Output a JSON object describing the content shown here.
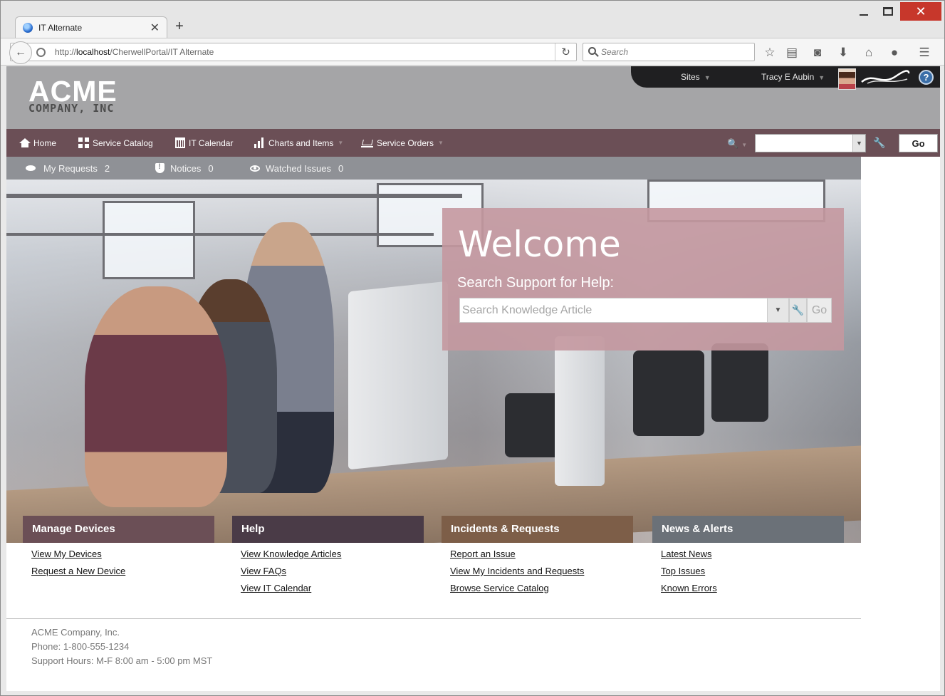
{
  "browser": {
    "tab_title": "IT Alternate",
    "url_prefix": "http://",
    "url_host": "localhost",
    "url_path": "/CherwellPortal/IT Alternate",
    "search_placeholder": "Search"
  },
  "header": {
    "logo_main": "ACME",
    "logo_sub": "COMPANY, INC",
    "sites_label": "Sites",
    "user_name": "Tracy E Aubin",
    "help_label": "?"
  },
  "nav": {
    "items": [
      {
        "label": "Home"
      },
      {
        "label": "Service Catalog"
      },
      {
        "label": "IT Calendar"
      },
      {
        "label": "Charts and Items"
      },
      {
        "label": "Service Orders"
      }
    ],
    "go_label": "Go"
  },
  "subnav": {
    "my_requests": {
      "label": "My Requests",
      "count": "2"
    },
    "notices": {
      "label": "Notices",
      "count": "0"
    },
    "watched": {
      "label": "Watched Issues",
      "count": "0"
    }
  },
  "welcome": {
    "title": "Welcome",
    "subtitle": "Search Support for Help:",
    "search_placeholder": "Search Knowledge Article",
    "go_label": "Go"
  },
  "tiles": [
    {
      "title": "Manage Devices",
      "color": "#6b4f56",
      "links": [
        "View My Devices",
        "Request a New Device"
      ]
    },
    {
      "title": "Help",
      "color": "#4a3b47",
      "links": [
        "View Knowledge Articles",
        "View FAQs",
        "View IT Calendar"
      ]
    },
    {
      "title": "Incidents & Requests",
      "color": "#7d5e48",
      "links": [
        "Report an Issue",
        "View My Incidents and Requests",
        "Browse Service Catalog"
      ]
    },
    {
      "title": "News & Alerts",
      "color": "#6b7178",
      "links": [
        "Latest News",
        "Top Issues",
        "Known Errors"
      ]
    }
  ],
  "footer": {
    "company": "ACME Company, Inc.",
    "phone": "Phone: 1-800-555-1234",
    "hours": "Support Hours: M-F 8:00 am - 5:00 pm MST"
  }
}
